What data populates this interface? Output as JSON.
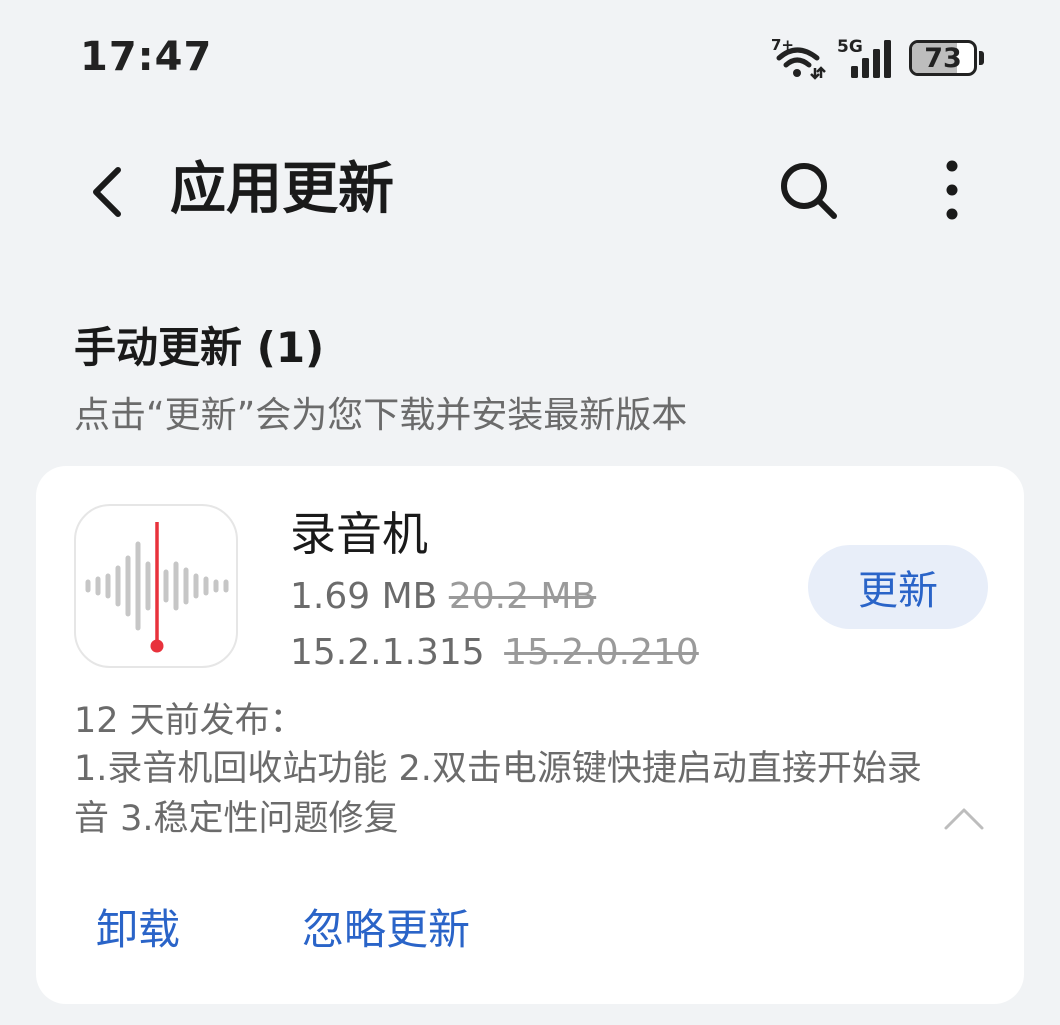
{
  "status_bar": {
    "time": "17:47",
    "icons": [
      "wifi-6-plus-icon",
      "5g-signal-icon",
      "battery-icon"
    ],
    "wifi_label": "7+",
    "network_label": "5G",
    "battery_level": "73",
    "battery_fraction": 0.73
  },
  "header": {
    "title": "应用更新",
    "icons": [
      "back-arrow-icon",
      "search-icon",
      "more-vertical-icon"
    ]
  },
  "section": {
    "title": "手动更新 (1)",
    "subtitle": "点击“更新”会为您下载并安装最新版本"
  },
  "app": {
    "name": "录音机",
    "icon": "voice-recorder-icon",
    "new_size": "1.69 MB",
    "old_size": "20.2 MB",
    "new_version": "15.2.1.315",
    "old_version": "15.2.0.210",
    "update_label": "更新",
    "release_date": "12 天前发布：",
    "release_notes": "1.录音机回收站功能 2.双击电源键快捷启动直接开始录音 3.稳定性问题修复",
    "uninstall_label": "卸载",
    "ignore_label": "忽略更新"
  },
  "colors": {
    "background": "#f1f3f5",
    "card": "#ffffff",
    "accent": "#2a64c8",
    "accent_bg": "#e8eef9",
    "recorder_red": "#e8323c"
  }
}
